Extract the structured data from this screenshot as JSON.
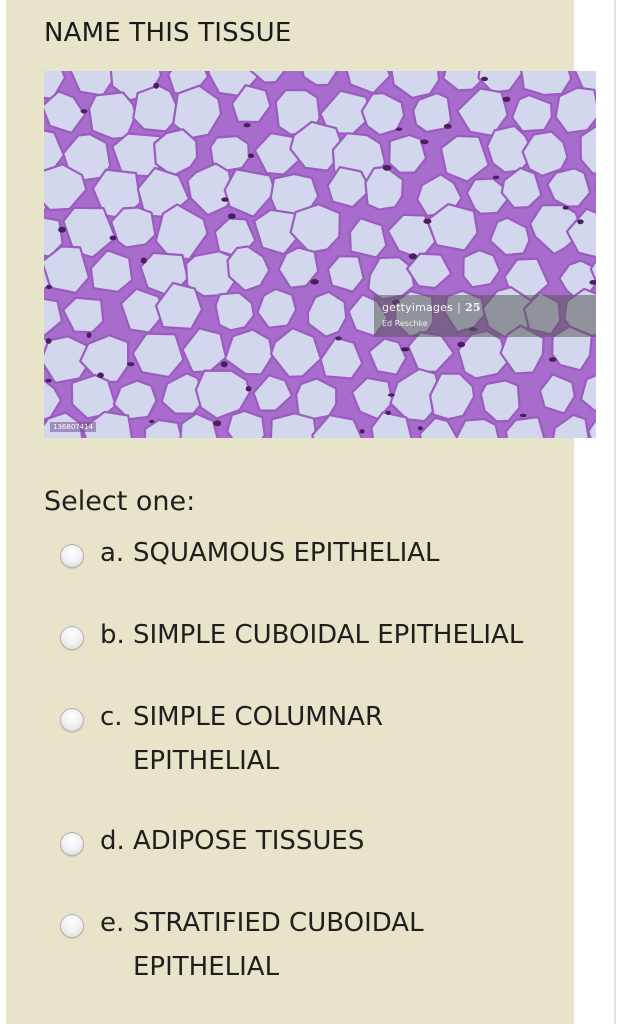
{
  "question": {
    "title": "NAME THIS TISSUE",
    "prompt": "Select one:"
  },
  "image": {
    "subject": "adipose tissue micrograph",
    "watermark_brand": "gettyimages",
    "watermark_badge": "25",
    "watermark_credit": "Ed Reschke",
    "watermark_id": "136807414"
  },
  "options": [
    {
      "letter": "a.",
      "text": "SQUAMOUS EPITHELIAL"
    },
    {
      "letter": "b.",
      "text": "SIMPLE CUBOIDAL EPITHELIAL"
    },
    {
      "letter": "c.",
      "text": "SIMPLE COLUMNAR EPITHELIAL"
    },
    {
      "letter": "d.",
      "text": "ADIPOSE TISSUES"
    },
    {
      "letter": "e.",
      "text": "STRATIFIED CUBOIDAL EPITHELIAL"
    }
  ],
  "colors": {
    "panel": "#e8e4c9",
    "stain": "#9b5cc0",
    "cell": "#d3d7ee",
    "nucleus": "#4a1f5e"
  }
}
